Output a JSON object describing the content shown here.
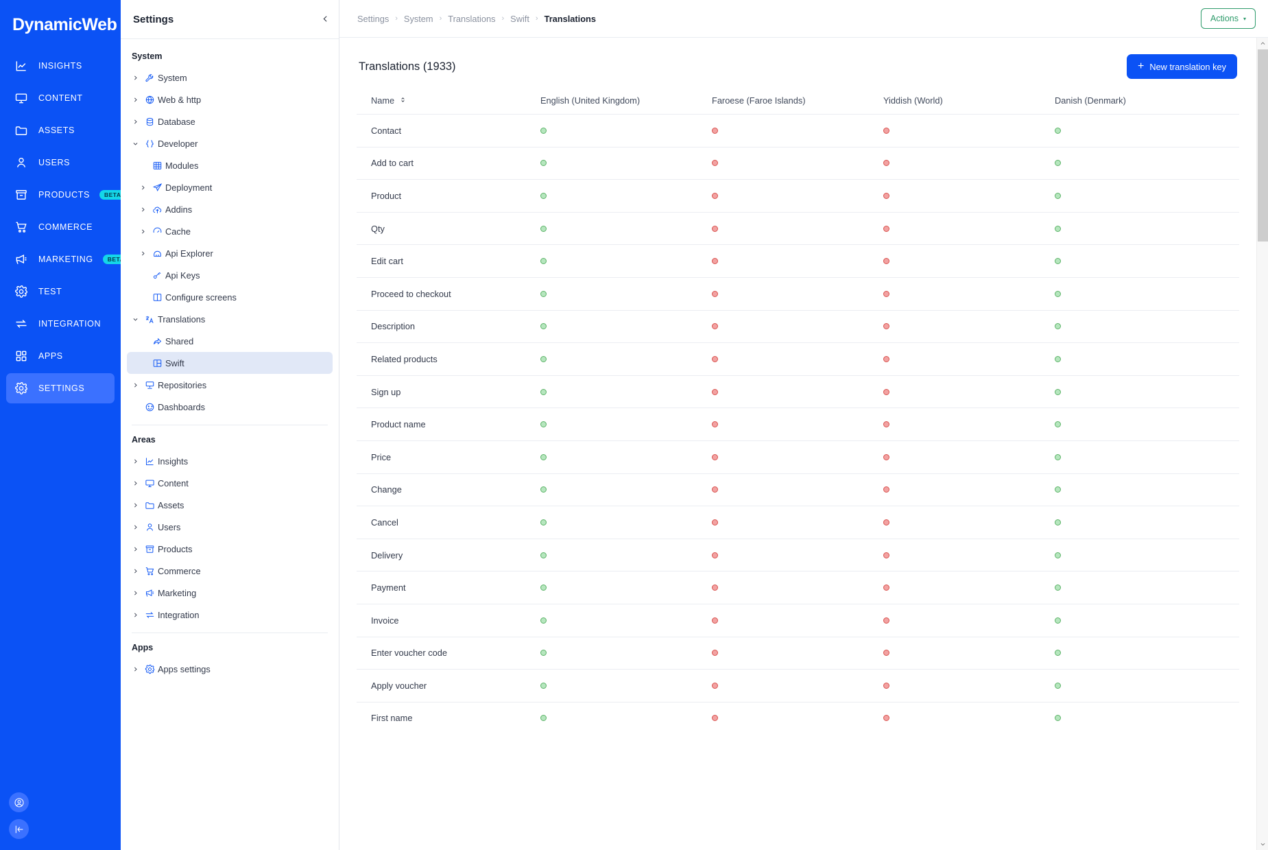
{
  "brand": {
    "name": "DynamicWeb"
  },
  "rail": {
    "items": [
      {
        "label": "INSIGHTS",
        "icon": "chart-line-icon",
        "badge": null,
        "active": false
      },
      {
        "label": "CONTENT",
        "icon": "monitor-icon",
        "badge": null,
        "active": false
      },
      {
        "label": "ASSETS",
        "icon": "folder-icon",
        "badge": null,
        "active": false
      },
      {
        "label": "USERS",
        "icon": "user-icon",
        "badge": null,
        "active": false
      },
      {
        "label": "PRODUCTS",
        "icon": "box-icon",
        "badge": "BETA",
        "active": false
      },
      {
        "label": "COMMERCE",
        "icon": "cart-icon",
        "badge": null,
        "active": false
      },
      {
        "label": "MARKETING",
        "icon": "megaphone-icon",
        "badge": "BETA",
        "active": false
      },
      {
        "label": "TEST",
        "icon": "gear-icon",
        "badge": null,
        "active": false
      },
      {
        "label": "INTEGRATION",
        "icon": "exchange-icon",
        "badge": null,
        "active": false
      },
      {
        "label": "APPS",
        "icon": "grid-icon",
        "badge": null,
        "active": false
      },
      {
        "label": "SETTINGS",
        "icon": "gear-icon",
        "badge": null,
        "active": true
      }
    ],
    "bottom": [
      {
        "icon": "user-circle-icon",
        "name": "user-account-button"
      },
      {
        "icon": "collapse-left-icon",
        "name": "collapse-rail-button"
      }
    ]
  },
  "settings_panel": {
    "title": "Settings",
    "collapse_icon": "chevron-left-icon",
    "groups": [
      {
        "title": "System",
        "items": [
          {
            "label": "System",
            "icon": "wrench-icon",
            "level": 0,
            "chevron": "right",
            "selected": false
          },
          {
            "label": "Web & http",
            "icon": "globe-icon",
            "level": 0,
            "chevron": "right",
            "selected": false
          },
          {
            "label": "Database",
            "icon": "database-icon",
            "level": 0,
            "chevron": "right",
            "selected": false
          },
          {
            "label": "Developer",
            "icon": "braces-icon",
            "level": 0,
            "chevron": "down",
            "selected": false
          },
          {
            "label": "Modules",
            "icon": "table-grid-icon",
            "level": 1,
            "chevron": null,
            "selected": false
          },
          {
            "label": "Deployment",
            "icon": "send-icon",
            "level": 1,
            "chevron": "right",
            "selected": false
          },
          {
            "label": "Addins",
            "icon": "cloud-upload-icon",
            "level": 1,
            "chevron": "right",
            "selected": false
          },
          {
            "label": "Cache",
            "icon": "gauge-icon",
            "level": 1,
            "chevron": "right",
            "selected": false
          },
          {
            "label": "Api Explorer",
            "icon": "api-explorer-icon",
            "level": 1,
            "chevron": "right",
            "selected": false
          },
          {
            "label": "Api Keys",
            "icon": "key-icon",
            "level": 1,
            "chevron": null,
            "selected": false
          },
          {
            "label": "Configure screens",
            "icon": "columns-icon",
            "level": 1,
            "chevron": null,
            "selected": false
          },
          {
            "label": "Translations",
            "icon": "translate-icon",
            "level": 0,
            "chevron": "down",
            "selected": false
          },
          {
            "label": "Shared",
            "icon": "share-arrow-icon",
            "level": 1,
            "chevron": null,
            "selected": false
          },
          {
            "label": "Swift",
            "icon": "layout-panel-icon",
            "level": 1,
            "chevron": null,
            "selected": true
          },
          {
            "label": "Repositories",
            "icon": "server-icon",
            "level": 0,
            "chevron": "right",
            "selected": false
          },
          {
            "label": "Dashboards",
            "icon": "dashboard-icon",
            "level": 0,
            "chevron": null,
            "selected": false
          }
        ]
      },
      {
        "title": "Areas",
        "items": [
          {
            "label": "Insights",
            "icon": "chart-line-icon",
            "level": 0,
            "chevron": "right",
            "selected": false
          },
          {
            "label": "Content",
            "icon": "monitor-icon",
            "level": 0,
            "chevron": "right",
            "selected": false
          },
          {
            "label": "Assets",
            "icon": "folder-icon",
            "level": 0,
            "chevron": "right",
            "selected": false
          },
          {
            "label": "Users",
            "icon": "user-icon",
            "level": 0,
            "chevron": "right",
            "selected": false
          },
          {
            "label": "Products",
            "icon": "box-icon",
            "level": 0,
            "chevron": "right",
            "selected": false
          },
          {
            "label": "Commerce",
            "icon": "cart-icon",
            "level": 0,
            "chevron": "right",
            "selected": false
          },
          {
            "label": "Marketing",
            "icon": "megaphone-icon",
            "level": 0,
            "chevron": "right",
            "selected": false
          },
          {
            "label": "Integration",
            "icon": "exchange-icon",
            "level": 0,
            "chevron": "right",
            "selected": false
          }
        ]
      },
      {
        "title": "Apps",
        "items": [
          {
            "label": "Apps settings",
            "icon": "gear-icon",
            "level": 0,
            "chevron": "right",
            "selected": false
          }
        ]
      }
    ]
  },
  "topbar": {
    "breadcrumb": [
      "Settings",
      "System",
      "Translations",
      "Swift",
      "Translations"
    ],
    "separator": "›",
    "actions_label": "Actions",
    "actions_caret": "▾"
  },
  "page": {
    "title": "Translations (1933)",
    "new_button_label": "New translation key",
    "new_button_icon": "plus-icon",
    "accent_blue": "#0B52F5",
    "accent_green": "#2E9B6B"
  },
  "table": {
    "columns": [
      {
        "label": "Name",
        "sortable": true,
        "sort_icon": "sort-updown-icon"
      },
      {
        "label": "English (United Kingdom)",
        "sortable": false
      },
      {
        "label": "Faroese (Faroe Islands)",
        "sortable": false
      },
      {
        "label": "Yiddish (World)",
        "sortable": false
      },
      {
        "label": "Danish (Denmark)",
        "sortable": false
      }
    ],
    "status_colors": {
      "ok_fill": "#B6E6BE",
      "ok_border": "#5CB368",
      "missing_fill": "#F2A2A2",
      "missing_border": "#D9534F"
    },
    "rows": [
      {
        "name": "Contact",
        "statuses": [
          "ok",
          "missing",
          "missing",
          "ok"
        ]
      },
      {
        "name": "Add to cart",
        "statuses": [
          "ok",
          "missing",
          "missing",
          "ok"
        ]
      },
      {
        "name": "Product",
        "statuses": [
          "ok",
          "missing",
          "missing",
          "ok"
        ]
      },
      {
        "name": "Qty",
        "statuses": [
          "ok",
          "missing",
          "missing",
          "ok"
        ]
      },
      {
        "name": "Edit cart",
        "statuses": [
          "ok",
          "missing",
          "missing",
          "ok"
        ]
      },
      {
        "name": "Proceed to checkout",
        "statuses": [
          "ok",
          "missing",
          "missing",
          "ok"
        ]
      },
      {
        "name": "Description",
        "statuses": [
          "ok",
          "missing",
          "missing",
          "ok"
        ]
      },
      {
        "name": "Related products",
        "statuses": [
          "ok",
          "missing",
          "missing",
          "ok"
        ]
      },
      {
        "name": "Sign up",
        "statuses": [
          "ok",
          "missing",
          "missing",
          "ok"
        ]
      },
      {
        "name": "Product name",
        "statuses": [
          "ok",
          "missing",
          "missing",
          "ok"
        ]
      },
      {
        "name": "Price",
        "statuses": [
          "ok",
          "missing",
          "missing",
          "ok"
        ]
      },
      {
        "name": "Change",
        "statuses": [
          "ok",
          "missing",
          "missing",
          "ok"
        ]
      },
      {
        "name": "Cancel",
        "statuses": [
          "ok",
          "missing",
          "missing",
          "ok"
        ]
      },
      {
        "name": "Delivery",
        "statuses": [
          "ok",
          "missing",
          "missing",
          "ok"
        ]
      },
      {
        "name": "Payment",
        "statuses": [
          "ok",
          "missing",
          "missing",
          "ok"
        ]
      },
      {
        "name": "Invoice",
        "statuses": [
          "ok",
          "missing",
          "missing",
          "ok"
        ]
      },
      {
        "name": "Enter voucher code",
        "statuses": [
          "ok",
          "missing",
          "missing",
          "ok"
        ]
      },
      {
        "name": "Apply voucher",
        "statuses": [
          "ok",
          "missing",
          "missing",
          "ok"
        ]
      },
      {
        "name": "First name",
        "statuses": [
          "ok",
          "missing",
          "missing",
          "ok"
        ]
      }
    ]
  },
  "scrollbar": {
    "up_icon": "chevron-up-icon",
    "down_icon": "chevron-down-icon"
  }
}
